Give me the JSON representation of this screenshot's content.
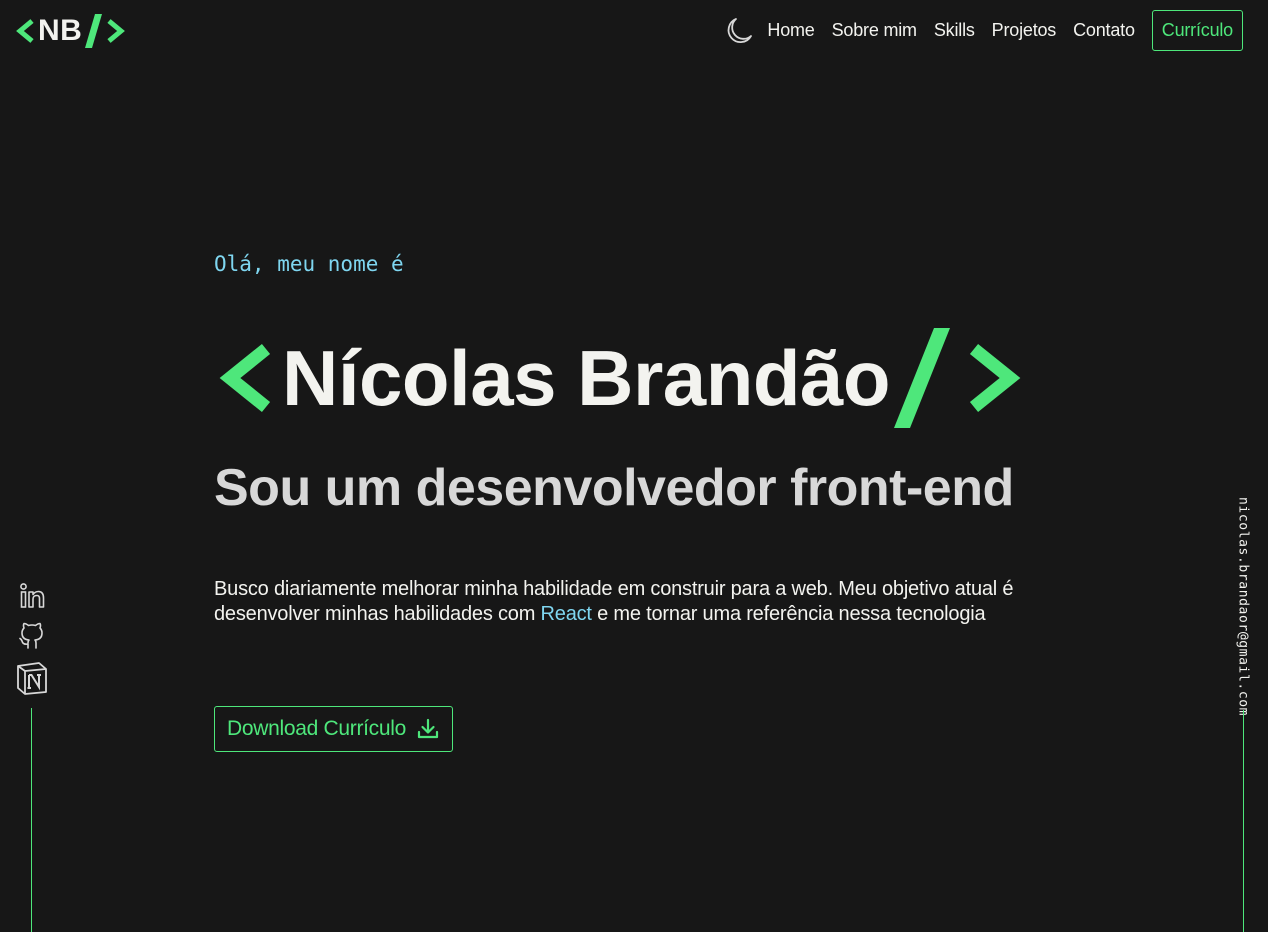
{
  "brand": {
    "logo_text": "NB",
    "accent_color": "#4ee77b",
    "link_color": "#7fd6f0",
    "background": "#171717"
  },
  "header": {
    "theme_toggle_icon": "moon-icon",
    "nav": [
      {
        "label": "Home"
      },
      {
        "label": "Sobre mim"
      },
      {
        "label": "Skills"
      },
      {
        "label": "Projetos"
      },
      {
        "label": "Contato"
      }
    ],
    "resume_button": "Currículo"
  },
  "hero": {
    "greeting": "Olá, meu nome é",
    "name": "Nícolas Brandão",
    "tagline": "Sou um desenvolvedor front-end",
    "bio_before": "Busco diariamente melhorar minha habilidade em construir para a web. Meu objetivo atual é desenvolver minhas habilidades com ",
    "bio_highlight": "React",
    "bio_after": " e me tornar uma referência nessa tecnologia",
    "download_label": "Download Currículo",
    "download_icon": "download-icon"
  },
  "social": [
    {
      "name": "linkedin-icon"
    },
    {
      "name": "github-icon"
    },
    {
      "name": "notion-icon"
    }
  ],
  "email": "nicolas.brandaor@gmail.com"
}
